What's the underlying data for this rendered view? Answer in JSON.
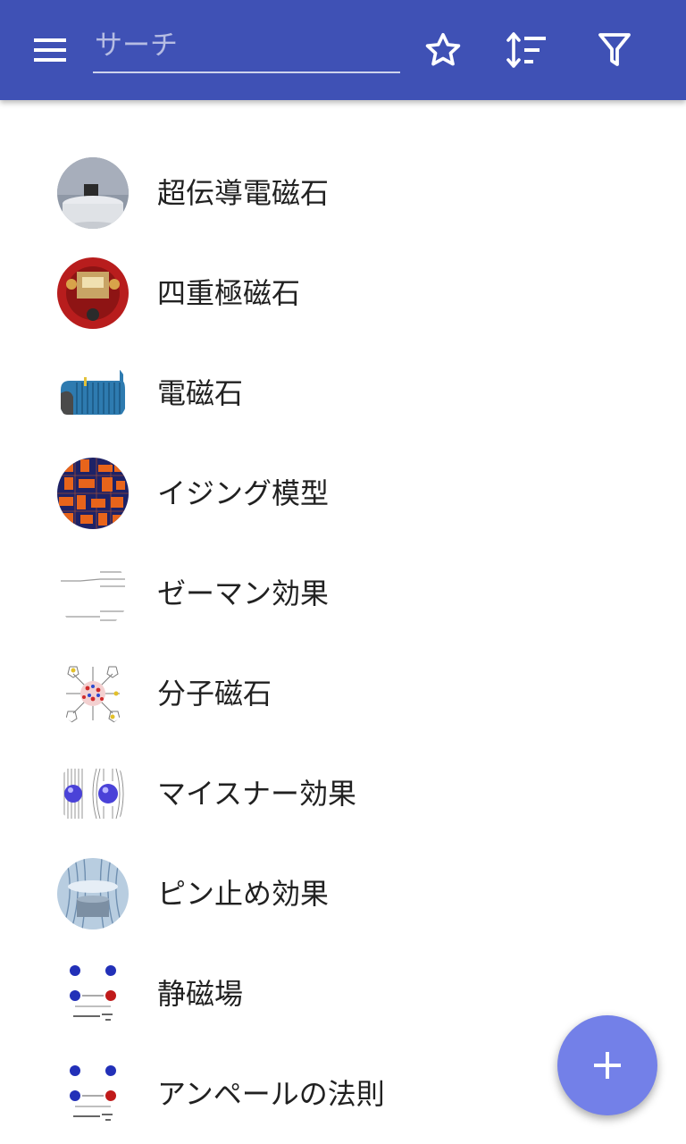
{
  "toolbar": {
    "search_placeholder": "サーチ",
    "icons": [
      "menu-icon",
      "star-icon",
      "sort-icon",
      "filter-icon"
    ],
    "color": "#3f51b5"
  },
  "items": [
    {
      "label": "超伝導電磁石",
      "thumbnail": "superconducting-magnet-photo"
    },
    {
      "label": "四重極磁石",
      "thumbnail": "quadrupole-magnet-photo"
    },
    {
      "label": "電磁石",
      "thumbnail": "electromagnet-coil-drawing"
    },
    {
      "label": "イジング模型",
      "thumbnail": "ising-lattice-pattern"
    },
    {
      "label": "ゼーマン効果",
      "thumbnail": "zeeman-energy-levels-diagram"
    },
    {
      "label": "分子磁石",
      "thumbnail": "molecular-magnet-structure"
    },
    {
      "label": "マイスナー効果",
      "thumbnail": "meissner-field-lines-diagram"
    },
    {
      "label": "ピン止め効果",
      "thumbnail": "flux-pinning-photo"
    },
    {
      "label": "静磁場",
      "thumbnail": "magnetic-poles-diagram"
    },
    {
      "label": "アンペールの法則",
      "thumbnail": "magnetic-poles-diagram"
    }
  ],
  "fab": {
    "icon": "plus-icon",
    "color": "#7380e8"
  }
}
